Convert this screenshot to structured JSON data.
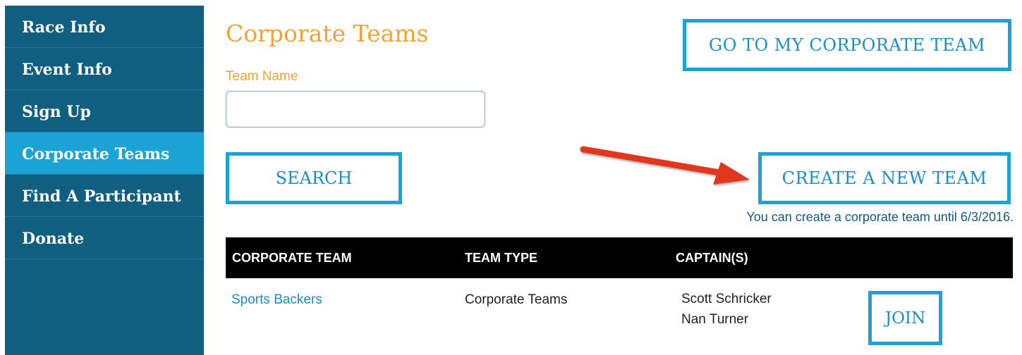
{
  "sidebar": {
    "items": [
      {
        "label": "Race Info",
        "active": false
      },
      {
        "label": "Event Info",
        "active": false
      },
      {
        "label": "Sign Up",
        "active": false
      },
      {
        "label": "Corporate Teams",
        "active": true
      },
      {
        "label": "Find A Participant",
        "active": false
      },
      {
        "label": "Donate",
        "active": false
      }
    ]
  },
  "main": {
    "title": "Corporate Teams",
    "team_name_label": "Team Name",
    "team_name_value": "",
    "go_to_team_label": "GO TO MY CORPORATE TEAM",
    "search_label": "SEARCH",
    "create_team_label": "CREATE A NEW TEAM",
    "create_note": "You can create a corporate team until 6/3/2016."
  },
  "table": {
    "columns": [
      "CORPORATE TEAM",
      "TEAM TYPE",
      "CAPTAIN(S)"
    ],
    "rows": [
      {
        "team": "Sports Backers",
        "type": "Corporate Teams",
        "captains": [
          "Scott Schricker",
          "Nan Turner"
        ],
        "action": "JOIN"
      }
    ]
  },
  "colors": {
    "sidebar_bg": "#115f80",
    "sidebar_active": "#1ba3d6",
    "accent_orange": "#f2a331",
    "button_border": "#1ba3d6",
    "annotation_arrow": "#e0391f"
  },
  "icons": {
    "annotation": "red-arrow-icon"
  }
}
